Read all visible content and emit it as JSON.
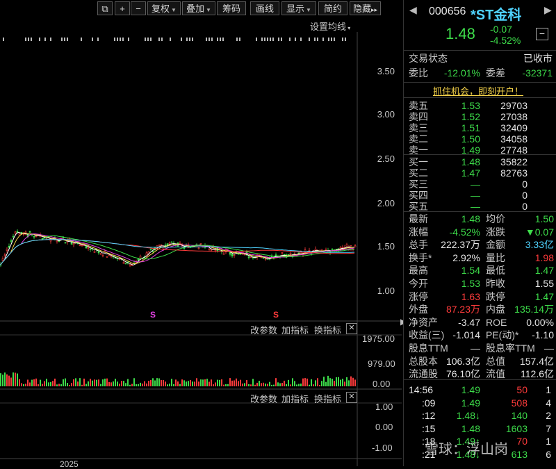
{
  "toolbar": {
    "buttons": [
      "+",
      "−",
      "复权",
      "叠加",
      "筹码",
      "画线",
      "显示",
      "简约",
      "隐藏"
    ],
    "expand": "▸▸"
  },
  "chart": {
    "ma_setting": "设置均线",
    "price_ticks": [
      "3.50",
      "3.00",
      "2.50",
      "2.00",
      "1.50",
      "1.00"
    ],
    "vol_ticks": [
      "1975.00",
      "979.00",
      "0.00"
    ],
    "osc_ticks": [
      "1.00",
      "0.00",
      "-1.00"
    ],
    "panel_buttons": [
      "改参数",
      "加指标",
      "换指标"
    ],
    "year_label": "2025",
    "markers": [
      "S",
      "S"
    ]
  },
  "quote": {
    "code": "000656",
    "name": "*ST金科",
    "price": "1.48",
    "change": "-0.07",
    "change_pct": "-4.52%",
    "status_label": "交易状态",
    "status_value": "已收市",
    "weibi_label": "委比",
    "weibi_value": "-12.01%",
    "weicha_label": "委差",
    "weicha_value": "-32371",
    "promo": "抓住机会，即刻开户！"
  },
  "asks": [
    {
      "label": "卖五",
      "price": "1.53",
      "vol": "29703"
    },
    {
      "label": "卖四",
      "price": "1.52",
      "vol": "27038"
    },
    {
      "label": "卖三",
      "price": "1.51",
      "vol": "32409"
    },
    {
      "label": "卖二",
      "price": "1.50",
      "vol": "34058"
    },
    {
      "label": "卖一",
      "price": "1.49",
      "vol": "27748"
    }
  ],
  "bids": [
    {
      "label": "买一",
      "price": "1.48",
      "vol": "35822"
    },
    {
      "label": "买二",
      "price": "1.47",
      "vol": "82763"
    },
    {
      "label": "买三",
      "price": "—",
      "vol": "0"
    },
    {
      "label": "买四",
      "price": "—",
      "vol": "0"
    },
    {
      "label": "买五",
      "price": "—",
      "vol": "0"
    }
  ],
  "stats": [
    {
      "l1": "最新",
      "v1": "1.48",
      "c1": "green",
      "l2": "均价",
      "v2": "1.50",
      "c2": "green"
    },
    {
      "l1": "涨幅",
      "v1": "-4.52%",
      "c1": "green",
      "l2": "涨跌",
      "v2": "▼0.07",
      "c2": "green"
    },
    {
      "l1": "总手",
      "v1": "222.37万",
      "c1": "white",
      "l2": "金额",
      "v2": "3.33亿",
      "c2": "cyan"
    },
    {
      "l1": "换手*",
      "v1": "2.92%",
      "c1": "white",
      "l2": "量比",
      "v2": "1.98",
      "c2": "red"
    },
    {
      "l1": "最高",
      "v1": "1.54",
      "c1": "green",
      "l2": "最低",
      "v2": "1.47",
      "c2": "green"
    },
    {
      "l1": "今开",
      "v1": "1.53",
      "c1": "green",
      "l2": "昨收",
      "v2": "1.55",
      "c2": "white"
    },
    {
      "l1": "涨停",
      "v1": "1.63",
      "c1": "red",
      "l2": "跌停",
      "v2": "1.47",
      "c2": "green"
    },
    {
      "l1": "外盘",
      "v1": "87.23万",
      "c1": "red",
      "l2": "内盘",
      "v2": "135.14万",
      "c2": "green"
    },
    {
      "l1": "净资产",
      "v1": "-3.47",
      "c1": "white",
      "l2": "ROE",
      "v2": "0.00%",
      "c2": "white"
    },
    {
      "l1": "收益(三)",
      "v1": "-1.014",
      "c1": "white",
      "l2": "PE(动)*",
      "v2": "-1.10",
      "c2": "white"
    },
    {
      "l1": "股息TTM",
      "v1": "—",
      "c1": "white",
      "l2": "股息率TTM",
      "v2": "—",
      "c2": "white"
    },
    {
      "l1": "总股本",
      "v1": "106.3亿",
      "c1": "white",
      "l2": "总值",
      "v2": "157.4亿",
      "c2": "white"
    },
    {
      "l1": "流通股",
      "v1": "76.10亿",
      "c1": "white",
      "l2": "流值",
      "v2": "112.6亿",
      "c2": "white"
    }
  ],
  "ticks": [
    {
      "time": "14:56",
      "price": "1.49",
      "vol": "50",
      "n": "1",
      "pc": "green",
      "vc": "red"
    },
    {
      "time": ":09",
      "price": "1.49",
      "vol": "508",
      "n": "4",
      "pc": "green",
      "vc": "red"
    },
    {
      "time": ":12",
      "price": "1.48↓",
      "vol": "140",
      "n": "2",
      "pc": "green",
      "vc": "green"
    },
    {
      "time": ":15",
      "price": "1.48",
      "vol": "1603",
      "n": "7",
      "pc": "green",
      "vc": "green"
    },
    {
      "time": ":18",
      "price": "1.49↑",
      "vol": "70",
      "n": "1",
      "pc": "green",
      "vc": "red"
    },
    {
      "time": ":21",
      "price": "1.48↓",
      "vol": "613",
      "n": "6",
      "pc": "green",
      "vc": "green"
    }
  ],
  "watermark": "雪球：浮山岗",
  "colors": {
    "up": "#ff3b3b",
    "down": "#3ddc4a",
    "accent": "#4fd3ff"
  }
}
